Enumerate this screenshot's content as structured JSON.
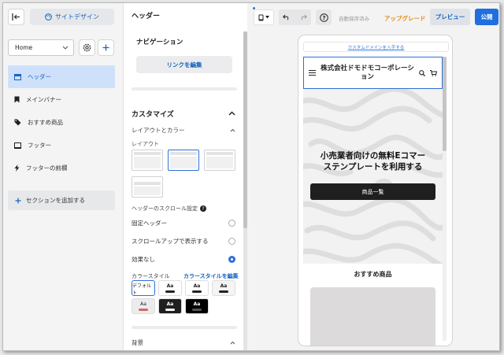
{
  "left": {
    "site_design_label": "サイトデザイン",
    "page_select_value": "Home",
    "sections": [
      {
        "label": "ヘッダー",
        "icon": "header-icon",
        "active": true
      },
      {
        "label": "メインバナー",
        "icon": "bookmark-icon",
        "active": false
      },
      {
        "label": "おすすめ商品",
        "icon": "tag-icon",
        "active": false
      },
      {
        "label": "フッター",
        "icon": "footer-icon",
        "active": false
      },
      {
        "label": "フッターの前欄",
        "icon": "bolt-icon",
        "active": false
      }
    ],
    "add_section_label": "セクションを追加する"
  },
  "panel": {
    "title": "ヘッダー",
    "navigation_label": "ナビゲーション",
    "link_edit_label": "リンクを編集",
    "customize_label": "カスタマイズ",
    "layout_color_label": "レイアウトとカラー",
    "layout_label": "レイアウト",
    "scroll_setting_label": "ヘッダーのスクロール設定",
    "scroll_options": [
      {
        "label": "固定ヘッダー",
        "selected": false
      },
      {
        "label": "スクロールアップで表示する",
        "selected": false
      },
      {
        "label": "効果なし",
        "selected": true
      }
    ],
    "color_style_label": "カラースタイル",
    "color_style_edit": "カラースタイルを編集",
    "swatches": [
      {
        "label": "デフォルト",
        "bg": "#ffffff",
        "fg": "#222222",
        "pill": "#222222"
      },
      {
        "label": "Aa",
        "bg": "#ffffff",
        "fg": "#222222",
        "pill": "#222222"
      },
      {
        "label": "Aa",
        "bg": "#ffffff",
        "fg": "#222222",
        "pill": "#222222"
      },
      {
        "label": "Aa",
        "bg": "#f4f4f4",
        "fg": "#222222",
        "pill": "#222222"
      },
      {
        "label": "Aa",
        "bg": "#ececec",
        "fg": "#222222",
        "pill": "#c96b6b"
      },
      {
        "label": "Aa",
        "bg": "#1f1f1f",
        "fg": "#ffffff",
        "pill": "#ffffff"
      },
      {
        "label": "Aa",
        "bg": "#000000",
        "fg": "#ffffff",
        "pill": "#555555"
      }
    ],
    "background_label": "背景"
  },
  "toolbar": {
    "autosave_label": "自動保存済み",
    "upgrade_label": "アップグレード",
    "preview_label": "プレビュー",
    "publish_label": "公開"
  },
  "preview": {
    "custom_domain_link": "カスタムドメインを入手する",
    "site_name": "株式会社ドモドモコーポレーション",
    "hero_title_line1": "小売業者向けの無料Eコマー",
    "hero_title_line2": "ステンプレートを利用する",
    "hero_button": "商品一覧",
    "featured_title": "おすすめ商品"
  },
  "colors": {
    "accent": "#1f6fde",
    "link": "#1565c0",
    "upgrade": "#e38b1a",
    "active_section_bg": "#cfe0fa"
  }
}
